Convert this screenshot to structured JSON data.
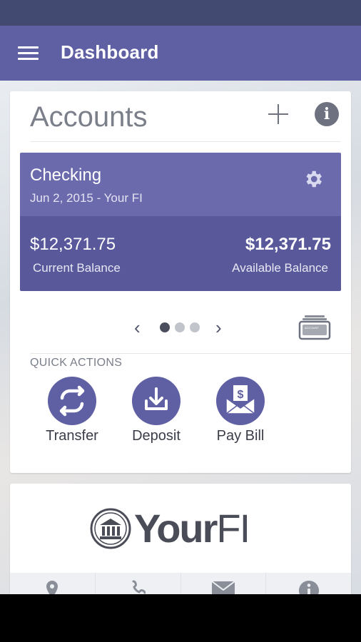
{
  "app_bar": {
    "title": "Dashboard"
  },
  "accounts_card": {
    "title": "Accounts",
    "account": {
      "name": "Checking",
      "subtitle": "Jun 2, 2015  - Your FI",
      "current_balance": "$12,371.75",
      "current_balance_label": "Current Balance",
      "available_balance": "$12,371.75",
      "available_balance_label": "Available Balance"
    },
    "pager": {
      "page_count": 3,
      "active_page": 1
    },
    "accounts_icon_label": "ACCOUNT"
  },
  "quick_actions": {
    "heading": "QUICK ACTIONS",
    "items": [
      {
        "label": "Transfer",
        "icon": "transfer-icon"
      },
      {
        "label": "Deposit",
        "icon": "deposit-icon"
      },
      {
        "label": "Pay Bill",
        "icon": "pay-bill-icon"
      }
    ]
  },
  "logo": {
    "bold_text": "Your",
    "light_text": "FI"
  },
  "bottom_tabs": [
    {
      "icon": "location-icon"
    },
    {
      "icon": "phone-icon"
    },
    {
      "icon": "mail-icon"
    },
    {
      "icon": "info-icon"
    }
  ],
  "colors": {
    "app_bar": "#5f5fa4",
    "status_bar": "#434a72",
    "account_header": "#6a6aad",
    "account_body": "#58589a",
    "quick_action_circle": "#5f5fa4"
  }
}
